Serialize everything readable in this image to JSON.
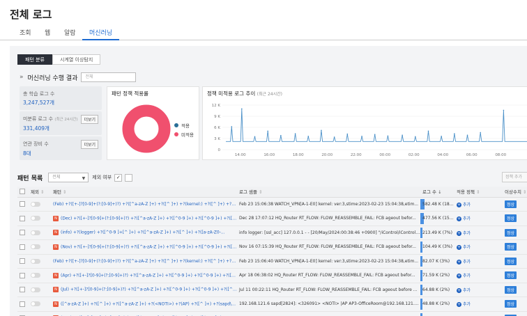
{
  "page": {
    "title": "전체 로그"
  },
  "tabs": [
    {
      "label": "조회"
    },
    {
      "label": "웹"
    },
    {
      "label": "알람"
    },
    {
      "label": "머신러닝"
    }
  ],
  "subtabs": [
    {
      "label": "패턴 분류"
    },
    {
      "label": "시계열 이상탐지"
    }
  ],
  "ml": {
    "title": "머신러닝 수행 결과",
    "search_placeholder": "전체"
  },
  "stats": {
    "total_label": "총 학습 로그 수",
    "total_value": "3,247,527개",
    "unclassified_label": "미분류 로그 수",
    "unclassified_sub": "(최근 24시간)",
    "unclassified_value": "331,409개",
    "devices_label": "연관 장비 수",
    "devices_value": "8대",
    "more_label": "더보기"
  },
  "pie_card": {
    "title": "패턴 정책 적용률",
    "legend": [
      {
        "label": "적용",
        "color": "#2a6f97"
      },
      {
        "label": "미적용",
        "color": "#f0506e"
      }
    ]
  },
  "trend_card": {
    "title": "정책 미적용 로그 추이",
    "subtitle": "(최근 24시간)"
  },
  "chart_data": {
    "type": "line",
    "x": [
      "14:00",
      "16:00",
      "18:00",
      "20:00",
      "22:00",
      "00:00",
      "02:00",
      "04:00",
      "06:00",
      "08:00"
    ],
    "yticks": [
      "12 K",
      "9 K",
      "6 K",
      "3 K",
      "0"
    ],
    "ylim": [
      0,
      12000
    ],
    "baseline": 2200,
    "spikes": [
      {
        "x": 0.2,
        "y": 6200
      },
      {
        "x": 0.55,
        "y": 11000
      },
      {
        "x": 1.0,
        "y": 3500
      },
      {
        "x": 1.45,
        "y": 5000
      },
      {
        "x": 1.9,
        "y": 3800
      },
      {
        "x": 2.4,
        "y": 4300
      },
      {
        "x": 2.85,
        "y": 3600
      },
      {
        "x": 3.3,
        "y": 5200
      },
      {
        "x": 3.75,
        "y": 3400
      },
      {
        "x": 4.2,
        "y": 4200
      },
      {
        "x": 4.7,
        "y": 3600
      },
      {
        "x": 5.15,
        "y": 4100
      },
      {
        "x": 5.6,
        "y": 3700
      },
      {
        "x": 6.1,
        "y": 3900
      },
      {
        "x": 6.55,
        "y": 3500
      },
      {
        "x": 7.0,
        "y": 5000
      },
      {
        "x": 7.45,
        "y": 3600
      },
      {
        "x": 7.9,
        "y": 4300
      },
      {
        "x": 8.35,
        "y": 3900
      },
      {
        "x": 8.8,
        "y": 4600
      },
      {
        "x": 9.6,
        "y": 10600
      }
    ]
  },
  "pie_data": {
    "applied": 0,
    "not_applied": 100
  },
  "list": {
    "title": "패턴 목록",
    "select_value": "전체",
    "exclude_label": "제외 여부",
    "policy_add_label": "정책 추가"
  },
  "table": {
    "headers": {
      "exclude": "제외",
      "pattern": "패턴",
      "sample": "로그 샘플",
      "count": "로그 수",
      "policy": "적용 정책",
      "anomaly": "이상수치"
    },
    "add_label": "추가",
    "rows": [
      {
        "badge": "",
        "pattern": "(Feb) +?([+-]?[0-9]+(?:[0-9]+)?) +?([^a-zA-Z ]+) +?([^ ]+) +?(kernel:) +?([^ ]+) +?([^ ]+) +?(...",
        "sample": "Feb 23 15:06:38 WATCH_VPN[A-1-E0] kernel: ver:3,stime:2023-02-23 15:04:38,etim...",
        "count": "582.48 K (18%)",
        "pct": 18,
        "status": "정상"
      },
      {
        "badge": "N",
        "pattern": "(Dec) +?([+-]?[0-9]+(?:[0-9]+)?) +?([^a-zA-Z ]+) +?([^0-9 ]+) +?([^0-9 ]+) +?([^0-9 ]+) +?...",
        "sample": "Dec 28 17:07:12 HQ_Router RT_FLOW: FLOW_REASSEMBLE_FAIL: FCB ageout befor...",
        "count": "477.56 K (15%)",
        "pct": 15,
        "status": "정상"
      },
      {
        "badge": "N",
        "pattern": "(info) +?(logger) +?([^0-9 ]+[^ ]+) +?([^a-zA-Z ]+) +?([^ ]+) +?([a-zA-Z0-...",
        "sample": "info logger: [ssl_acc] 127.0.0.1 - - [20/May/2024:00:38:46 +0900] \"/iControl/iControlPo...",
        "count": "213.49 K (7%)",
        "pct": 7,
        "status": "정상"
      },
      {
        "badge": "N",
        "pattern": "(Nov) +?([+-]?[0-9]+(?:[0-9]+)?) +?([^a-zA-Z ]+) +?([^0-9 ]+) +?([^0-9 ]+) +?([^0-9 ]+) +?...",
        "sample": "Nov 16 07:15:39 HQ_Router RT_FLOW: FLOW_REASSEMBLE_FAIL: FCB ageout befor...",
        "count": "104.49 K (3%)",
        "pct": 3,
        "status": "정상"
      },
      {
        "badge": "",
        "pattern": "(Feb) +?([+-]?[0-9]+(?:[0-9]+)?) +?([^a-zA-Z ]+) +?([^ ]+) +?(kernel:) +?([^ ]+) +?([^ ]+) +?(...",
        "sample": "Feb 23 15:06:40 WATCH_VPN[A-1-E0] kernel: ver:3,stime:2023-02-23 15:04:38,etim...",
        "count": "82.07 K (3%)",
        "pct": 3,
        "status": "정상"
      },
      {
        "badge": "N",
        "pattern": "(Apr) +?([+-]?[0-9]+(?:[0-9]+)?) +?([^a-zA-Z ]+) +?([^0-9 ]+) +?([^0-9 ]+) +?([^0-9 ]+) +?...",
        "sample": "Apr 18 06:38:02 HQ_Router RT_FLOW: FLOW_REASSEMBLE_FAIL: FCB ageout befor...",
        "count": "71.59 K (2%)",
        "pct": 2,
        "status": "정상"
      },
      {
        "badge": "N",
        "pattern": "(Jul) +?([+-]?[0-9]+(?:[0-9]+)?) +?([^a-zA-Z ]+) +?([^0-9 ]+) +?([^0-9 ]+) +?([^0-9 ]+) +?...",
        "sample": "Jul 11 00:22:11 HQ_Router RT_FLOW: FLOW_REASSEMBLE_FAIL: FCB ageout before ...",
        "count": "64.88 K (2%)",
        "pct": 2,
        "status": "정상"
      },
      {
        "badge": "N",
        "pattern": "([^a-zA-Z ]+) +?([^ ]+) +?([^a-zA-Z ]+) +?(<NOTI>) +?(AP) +?([^ ]+) +?(sapd\\) +?(ap...",
        "sample": "192.168.121.6 sapd[2824]: <326091> <NOTI> |AP AP3-OfficeRoom@192.168.121.6 ...",
        "count": "48.88 K (2%)",
        "pct": 2,
        "status": "정상"
      },
      {
        "badge": "N",
        "pattern": "(Mar) +?([+-]?[0-9]+(?:[0-9]+)?) +?([^a-zA-Z ]+) +?([^0-9 ]+) +?([^0-9 ]+) +?...",
        "sample": "Mar 29 04:41:09 HQ_Router RT_FLOW: FLOW_REASSEMBLE_FAIL: FCB ageout befor...",
        "count": "47.76 K (1%)",
        "pct": 1,
        "status": "정상"
      }
    ]
  }
}
